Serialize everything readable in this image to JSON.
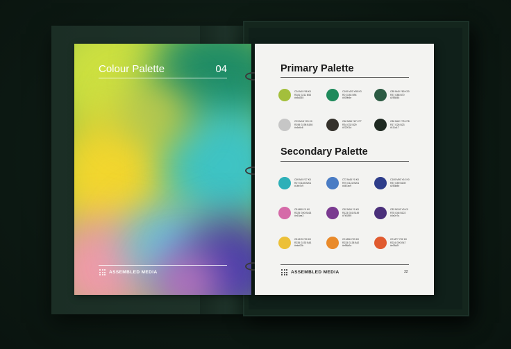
{
  "cover": {
    "title": "Colour Palette",
    "number": "04",
    "brand": "ASSEMBLED MEDIA"
  },
  "page": {
    "primary_title": "Primary Palette",
    "secondary_title": "Secondary Palette",
    "brand": "ASSEMBLED MEDIA",
    "page_number": "32",
    "primary": [
      {
        "color": "#a3bf3c",
        "lines": [
          "C34 M0 Y98 K0",
          "R181 G211 B53",
          "#b5d335"
        ]
      },
      {
        "color": "#1f8a5b",
        "lines": [
          "C100 M20 Y85 K3",
          "R0 G154 B94",
          "#009b5e"
        ]
      },
      {
        "color": "#2c5b43",
        "lines": [
          "C85 M40 Y80 K30",
          "R37 G88 B70",
          "#255846"
        ]
      },
      {
        "color": "#c6c6c6",
        "lines": [
          "C23 M18 Y20 K0",
          "R198 G198 B198",
          "#c6c6c6"
        ]
      },
      {
        "color": "#35322c",
        "lines": [
          "C60 M58 Y67 K77",
          "R34 G32 B29",
          "#22201d"
        ]
      },
      {
        "color": "#1f2a22",
        "lines": [
          "C80 M62 Y75 K78",
          "R17 G26 B23",
          "#111a17"
        ]
      }
    ],
    "secondary": [
      {
        "color": "#2eb0b8",
        "lines": [
          "C69 M0 Y27 K0",
          "R27 G183 B201",
          "#1bb7c9"
        ]
      },
      {
        "color": "#4a7cc4",
        "lines": [
          "C72 M48 Y0 K0",
          "R70 G122 B201",
          "#467ac9"
        ]
      },
      {
        "color": "#2e3d8a",
        "lines": [
          "C100 M90 Y10 K0",
          "R37 G59 B139",
          "#253b8b"
        ]
      },
      {
        "color": "#d56aa8",
        "lines": [
          "C8 M80 Y0 K0",
          "R225 G90 B163",
          "#e15aa3"
        ]
      },
      {
        "color": "#7a3a90",
        "lines": [
          "C62 M94 Y0 K0",
          "R123 G51 B149",
          "#7b3395"
        ]
      },
      {
        "color": "#4a2f7a",
        "lines": [
          "C83 M100 Y9 K0",
          "R78 G46 B122",
          "#4e2e7a"
        ]
      },
      {
        "color": "#ecc038",
        "lines": [
          "C8 M19 Y90 K0",
          "R235 G192 B43",
          "#ebc02b"
        ]
      },
      {
        "color": "#e98a2a",
        "lines": [
          "C0 M56 Y93 K0",
          "R233 G138 B42",
          "#e98a2a"
        ]
      },
      {
        "color": "#e05a2f",
        "lines": [
          "C0 M77 Y92 K0",
          "R224 G90 B47",
          "#e05a2f"
        ]
      }
    ]
  }
}
